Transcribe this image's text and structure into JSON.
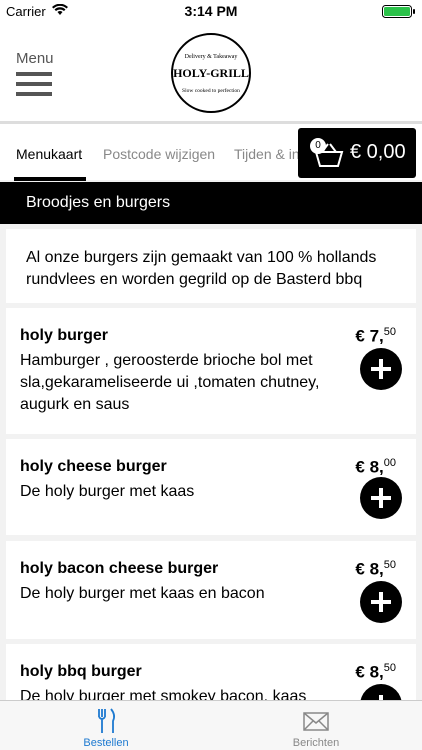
{
  "status_bar": {
    "carrier": "Carrier",
    "time": "3:14 PM"
  },
  "header": {
    "menu_label": "Menu",
    "logo": {
      "top": "Delivery & Takeaway",
      "name": "HOLY-GRILL",
      "tagline": "Slow cooked to perfection"
    }
  },
  "tabs": [
    {
      "label": "Menukaart",
      "active": true
    },
    {
      "label": "Postcode wijzigen",
      "active": false
    },
    {
      "label": "Tijden & info",
      "active": false
    }
  ],
  "cart": {
    "count": "0",
    "total": "€ 0,00"
  },
  "category": {
    "title": "Broodjes en burgers"
  },
  "intro": {
    "text": "Al onze burgers zijn gemaakt van 100 % hollands rundvlees en worden gegrild op de Basterd bbq"
  },
  "items": [
    {
      "name": "holy burger",
      "price_main": "€ 7,",
      "price_cents": "50",
      "description": "Hamburger , geroosterde brioche bol met sla,gekarameliseerde ui ,tomaten chutney, augurk en saus"
    },
    {
      "name": "holy cheese burger",
      "price_main": "€ 8,",
      "price_cents": "00",
      "description": "De holy burger met kaas"
    },
    {
      "name": "holy bacon cheese burger",
      "price_main": "€ 8,",
      "price_cents": "50",
      "description": "De holy burger met kaas en bacon"
    },
    {
      "name": "holy bbq burger",
      "price_main": "€ 8,",
      "price_cents": "50",
      "description": "De holy burger met smokey bacon, kaas"
    }
  ],
  "tabbar": [
    {
      "label": "Bestellen",
      "icon": "fork-knife-icon",
      "active": true
    },
    {
      "label": "Berichten",
      "icon": "envelope-icon",
      "active": false
    }
  ],
  "colors": {
    "accent": "#1e7ad0",
    "primary": "#000000",
    "background": "#f2f2f2"
  }
}
